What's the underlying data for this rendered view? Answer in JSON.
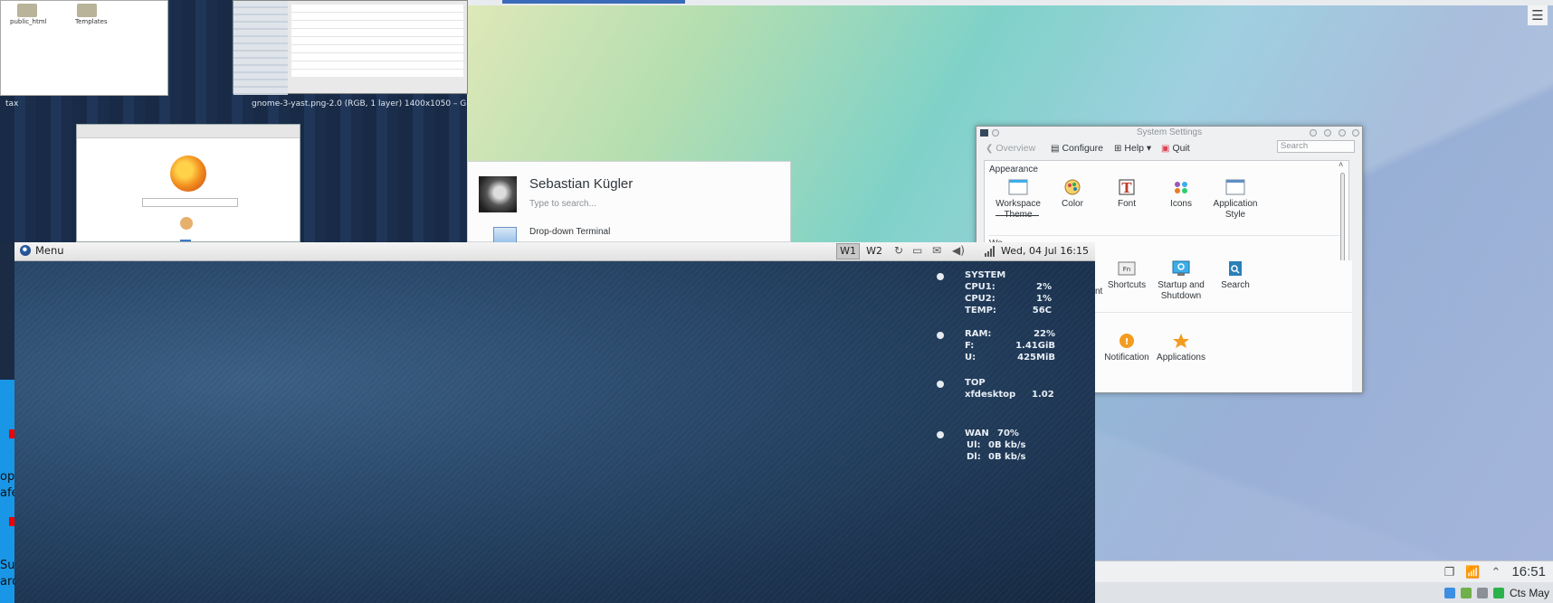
{
  "gnome": {
    "folders": [
      "public_html",
      "Templates"
    ],
    "tax_label": "tax",
    "gimp_caption": "gnome-3-yast.png-2.0 (RGB, 1 layer) 1400x1050 – GI"
  },
  "launcher": {
    "user_name": "Sebastian Kügler",
    "search_placeholder": "Type to search...",
    "first_app": "Drop-down Terminal"
  },
  "settings": {
    "title": "System Settings",
    "toolbar": {
      "overview": "Overview",
      "configure": "Configure",
      "help": "Help",
      "quit": "Quit",
      "search_placeholder": "Search"
    },
    "categories": [
      "Appearance",
      "Wo"
    ],
    "appearance_items": [
      {
        "label": "Workspace Theme",
        "icon": "workspace-theme-icon"
      },
      {
        "label": "Color",
        "icon": "color-icon"
      },
      {
        "label": "Font",
        "icon": "font-icon"
      },
      {
        "label": "Icons",
        "icon": "icons-icon"
      },
      {
        "label": "Application Style",
        "icon": "application-style-icon"
      }
    ],
    "workspace_items": [
      {
        "label": "Shortcuts",
        "icon": "shortcuts-icon"
      },
      {
        "label": "Startup and Shutdown",
        "icon": "startup-icon"
      },
      {
        "label": "Search",
        "icon": "search-icon"
      }
    ],
    "partial_item": "nt",
    "row3_items": [
      {
        "label": "Notification",
        "icon": "notification-icon"
      },
      {
        "label": "Applications",
        "icon": "applications-icon"
      }
    ]
  },
  "xfce": {
    "menu_label": "Menu",
    "workspaces": [
      "W1",
      "W2"
    ],
    "clock": "Wed, 04 Jul  16:15"
  },
  "conky": {
    "system": {
      "title": "SYSTEM",
      "rows": [
        {
          "label": "CPU1:",
          "value": "2%"
        },
        {
          "label": "CPU2:",
          "value": "1%"
        },
        {
          "label": "TEMP:",
          "value": "56C"
        }
      ]
    },
    "memory": {
      "rows": [
        {
          "label": "RAM:",
          "value": "22%"
        },
        {
          "label": "F:",
          "value": "1.41GiB"
        },
        {
          "label": "U:",
          "value": "425MiB"
        }
      ]
    },
    "top": {
      "title": "TOP",
      "process": "xfdesktop",
      "value": "1.02"
    },
    "net": {
      "rows": [
        {
          "label": "WAN",
          "value": "70%"
        },
        {
          "label": "Ul:",
          "value": "0B kb/s"
        },
        {
          "label": "Dl:",
          "value": "0B kb/s"
        }
      ]
    }
  },
  "kde_panel": {
    "clock": "16:51"
  },
  "bottom_strip": {
    "text": "Cts May"
  },
  "left_strip": {
    "fragments": [
      "op",
      "afe",
      "Sur",
      "ard"
    ]
  },
  "colors": {
    "accent_blue": "#3daee9",
    "panel_bg": "#eff0f1"
  }
}
